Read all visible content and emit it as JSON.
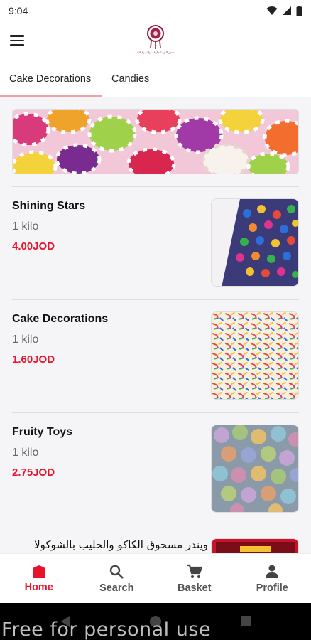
{
  "status_bar": {
    "time": "9:04"
  },
  "app": {
    "logo_caption": "متجر النور للحلويات والشوكولاته"
  },
  "tabs": [
    {
      "label": "Cake Decorations",
      "active": true
    },
    {
      "label": "Candies",
      "active": false
    }
  ],
  "products": [
    {
      "name": "Shining Stars",
      "weight": "1 kilo",
      "price": "4.00JOD"
    },
    {
      "name": "Cake Decorations",
      "weight": "1 kilo",
      "price": "1.60JOD"
    },
    {
      "name": "Fruity Toys",
      "weight": "1 kilo",
      "price": "2.75JOD"
    },
    {
      "name": "ويندر مسحوق الكاكو والحليب بالشوكولا"
    }
  ],
  "bottom_nav": [
    {
      "label": "Home",
      "icon": "home-icon",
      "active": true
    },
    {
      "label": "Search",
      "icon": "search-icon",
      "active": false
    },
    {
      "label": "Basket",
      "icon": "cart-icon",
      "active": false
    },
    {
      "label": "Profile",
      "icon": "profile-icon",
      "active": false
    }
  ],
  "watermark": "Free for personal use",
  "colors": {
    "accent": "#e8132b",
    "tab_indicator": "#f0a0a8",
    "background": "#f5f5f7"
  }
}
